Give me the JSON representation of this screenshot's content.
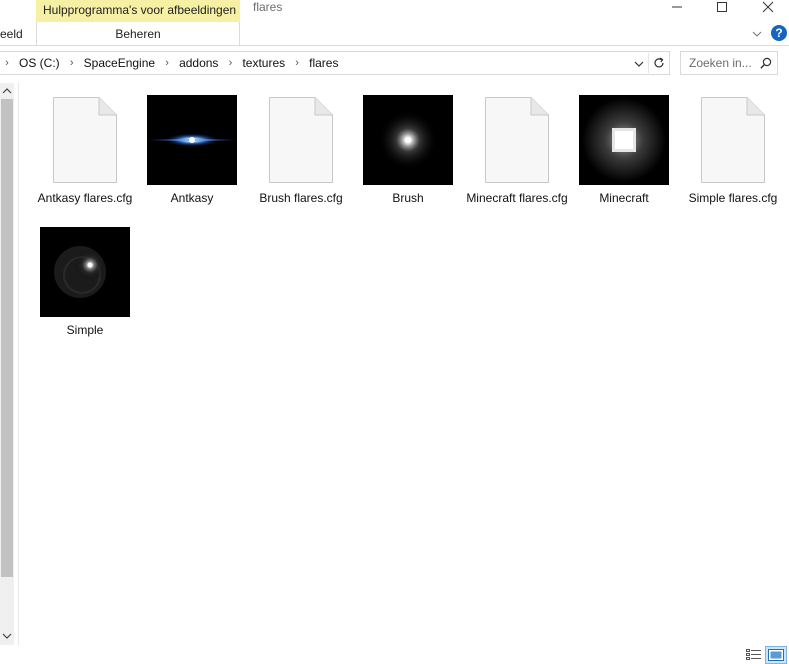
{
  "ribbon": {
    "tool_tab": "Hulpprogramma's voor afbeeldingen",
    "tab_partial": "eeld",
    "manage_tab": "Beheren",
    "help": "?"
  },
  "window": {
    "title": "flares"
  },
  "address": {
    "crumbs": [
      "OS (C:)",
      "SpaceEngine",
      "addons",
      "textures",
      "flares"
    ]
  },
  "search": {
    "placeholder": "Zoeken in..."
  },
  "items": [
    {
      "label": "Antkasy flares.cfg",
      "kind": "file",
      "icon": "document-icon"
    },
    {
      "label": "Antkasy",
      "kind": "image",
      "icon": "flare-blue-thumbnail"
    },
    {
      "label": "Brush flares.cfg",
      "kind": "file",
      "icon": "document-icon"
    },
    {
      "label": "Brush",
      "kind": "image",
      "icon": "flare-white-glow-thumbnail"
    },
    {
      "label": "Minecraft flares.cfg",
      "kind": "file",
      "icon": "document-icon"
    },
    {
      "label": "Minecraft",
      "kind": "image",
      "icon": "flare-square-thumbnail"
    },
    {
      "label": "Simple flares.cfg",
      "kind": "file",
      "icon": "document-icon"
    },
    {
      "label": "Simple",
      "kind": "image",
      "icon": "flare-simple-thumbnail"
    }
  ],
  "colors": {
    "tool_tab_bg": "#f5f0a3",
    "help_blue": "#1565c0",
    "selected_view_bg": "#cce4f7"
  }
}
